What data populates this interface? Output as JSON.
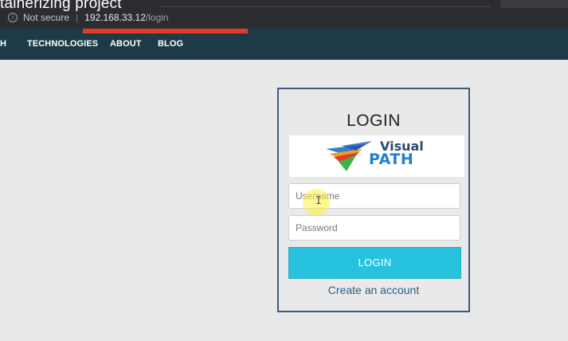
{
  "overlay_title": "tainerizing project",
  "browser": {
    "security_label": "Not secure",
    "separator": "|",
    "url_host": "192.168.33.12",
    "url_path": "/login",
    "icons": {
      "security": "info-icon"
    }
  },
  "nav": {
    "brand_fragment": "H",
    "items": [
      {
        "label": "TECHNOLOGIES"
      },
      {
        "label": "ABOUT"
      },
      {
        "label": "BLOG"
      }
    ]
  },
  "login": {
    "title": "LOGIN",
    "logo": {
      "word1": "Visual",
      "word2": "PATH"
    },
    "username_placeholder": "Username",
    "password_placeholder": "Password",
    "submit_label": "LOGIN",
    "create_account_label": "Create an account"
  },
  "colors": {
    "nav_bg": "#1d3b47",
    "button_bg": "#27c3de",
    "card_border": "#3e5a82",
    "link": "#2b5f86",
    "progress_bar": "#e53a26"
  }
}
